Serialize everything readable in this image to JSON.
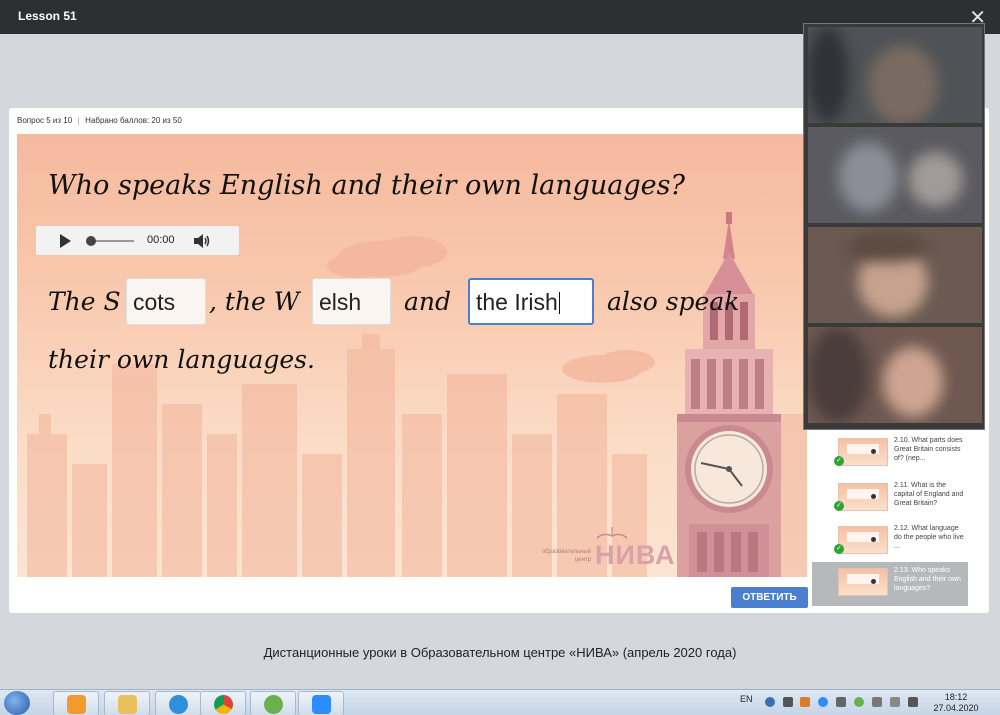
{
  "window": {
    "title": "Lesson 51",
    "close_glyph": "✕"
  },
  "quiz": {
    "question_counter": "Вопрос 5 из 10",
    "score": "Набрано баллов: 20 из 50",
    "heading": "Who speaks English and their own languages?",
    "audio": {
      "time": "00:00",
      "progress": 0
    },
    "sentence": {
      "part1": "The S",
      "blank1": "cots",
      "part2": ", the W",
      "blank2": "elsh",
      "part3": "and",
      "blank3": "the Irish",
      "part4": "also speak",
      "part5": "their own languages."
    },
    "submit_label": "ОТВЕТИТЬ",
    "logo": {
      "small_text": "образовательный центр",
      "big_text": "НИВА"
    }
  },
  "question_list": [
    {
      "text": "2.10. What parts does Great Britain consists of? (nep...",
      "done": true,
      "active": false
    },
    {
      "text": "2.11. What is the capital of England and Great Britain?",
      "done": true,
      "active": false
    },
    {
      "text": "2.12. What language do the people who live ...",
      "done": true,
      "active": false
    },
    {
      "text": "2.13. Who speaks English and their own languages?",
      "done": false,
      "active": true
    }
  ],
  "caption": "Дистанционные уроки в Образовательном центре «НИВА» (апрель 2020 года)",
  "taskbar": {
    "apps": [
      "media-player",
      "file-explorer",
      "internet-explorer",
      "chrome",
      "utorrent",
      "zoom"
    ],
    "lang": "EN",
    "time": "18:12",
    "date": "27.04.2020"
  },
  "colors": {
    "accent": "#4a7fd0",
    "slide_bg": "#f8c9ae",
    "check": "#2ea32e"
  }
}
